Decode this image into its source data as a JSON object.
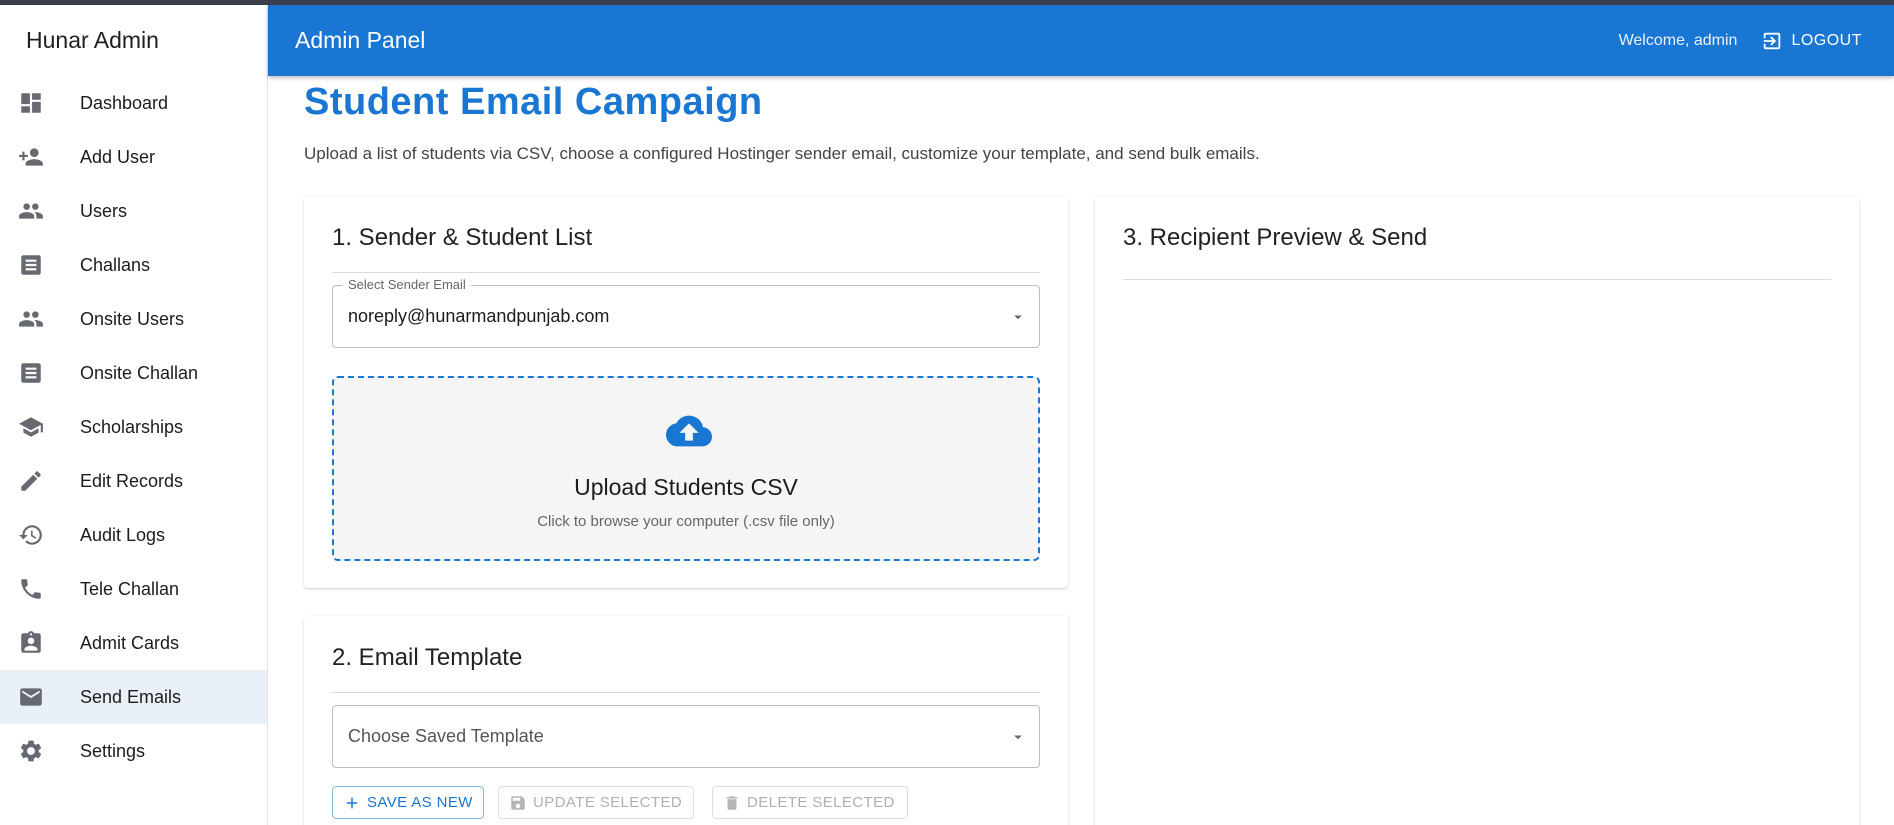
{
  "sidebar": {
    "brand": "Hunar Admin",
    "items": [
      {
        "label": "Dashboard",
        "icon": "dashboard-icon"
      },
      {
        "label": "Add User",
        "icon": "person-add-icon"
      },
      {
        "label": "Users",
        "icon": "people-icon"
      },
      {
        "label": "Challans",
        "icon": "receipt-icon"
      },
      {
        "label": "Onsite Users",
        "icon": "people-icon"
      },
      {
        "label": "Onsite Challan",
        "icon": "receipt-icon"
      },
      {
        "label": "Scholarships",
        "icon": "school-icon"
      },
      {
        "label": "Edit Records",
        "icon": "edit-icon"
      },
      {
        "label": "Audit Logs",
        "icon": "history-icon"
      },
      {
        "label": "Tele Challan",
        "icon": "phone-icon"
      },
      {
        "label": "Admit Cards",
        "icon": "badge-icon"
      },
      {
        "label": "Send Emails",
        "icon": "mail-icon",
        "active": true
      },
      {
        "label": "Settings",
        "icon": "gear-icon"
      }
    ]
  },
  "appbar": {
    "title": "Admin Panel",
    "welcome": "Welcome, admin",
    "logout_label": "LOGOUT",
    "color": "#1976d2"
  },
  "page": {
    "title": "Student Email Campaign",
    "subtitle": "Upload a list of students via CSV, choose a configured Hostinger sender email, customize your template, and send bulk emails."
  },
  "sender_card": {
    "title": "1. Sender & Student List",
    "sender_label": "Select Sender Email",
    "sender_value": "noreply@hunarmandpunjab.com",
    "upload_title": "Upload Students CSV",
    "upload_hint": "Click to browse your computer (.csv file only)"
  },
  "template_card": {
    "title": "2. Email Template",
    "template_placeholder": "Choose Saved Template",
    "save_label": "SAVE AS NEW",
    "update_label": "UPDATE SELECTED",
    "delete_label": "DELETE SELECTED"
  },
  "preview_card": {
    "title": "3. Recipient Preview & Send"
  }
}
